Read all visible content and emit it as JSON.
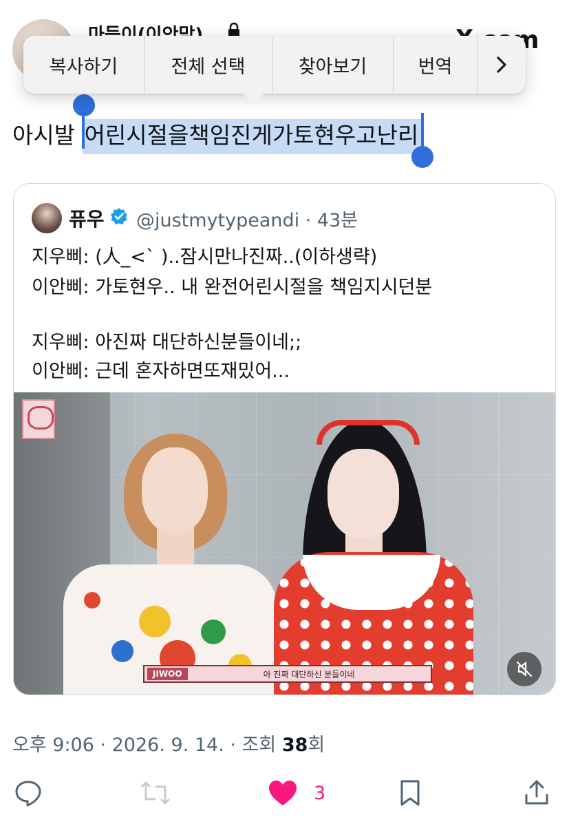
{
  "header": {
    "author_name": "마듣이(이안맘)",
    "site_logo": "X",
    "site_suffix": "com"
  },
  "context_menu": {
    "items": [
      "복사하기",
      "전체 선택",
      "찾아보기",
      "번역"
    ],
    "more_icon": "chevron-right-icon"
  },
  "tweet": {
    "text_plain": "아시발 ",
    "text_selected": "어린시절을책임진게가토현우고난리"
  },
  "quote": {
    "name": "퓨우",
    "verified_icon": "verified-badge-icon",
    "handle_time": "@justmytypeandi · 43분",
    "lines": [
      "지우삐: (人_<` )..잠시만나진짜..(이하생략)",
      "이안삐: 가토현우.. 내 완전어린시절을 책임지시던분",
      "지우삐: 아진짜 대단하신분들이네;;",
      "이안삐: 근데 혼자하면또재밌어..."
    ],
    "video": {
      "caption_name": "JIWOO",
      "caption_text": "아 진짜 대단하신 분들이네",
      "mute_icon": "speaker-muted-icon"
    }
  },
  "meta": {
    "timestamp": "오후 9:06 · 2026. 9. 14. · 조회 ",
    "views": "38",
    "views_suffix": "회"
  },
  "actions": {
    "like_count": "3",
    "colors": {
      "like": "#f91880",
      "icon": "#536471",
      "selection": "#c7dbf5",
      "handle": "#2f6fdc"
    }
  }
}
